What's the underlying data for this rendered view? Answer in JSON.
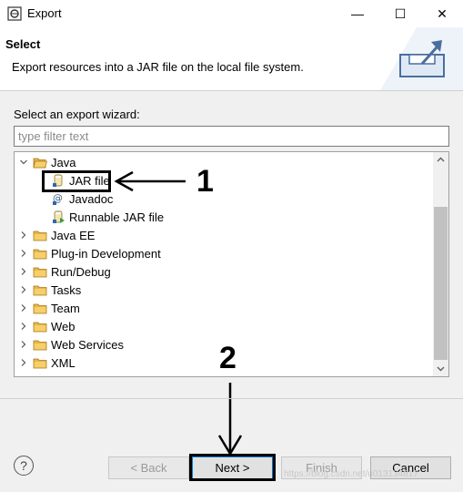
{
  "titlebar": {
    "title": "Export",
    "minimize": "—",
    "maximize": "☐",
    "close": "✕"
  },
  "banner": {
    "title": "Select",
    "description": "Export resources into a JAR file on the local file system."
  },
  "wizard": {
    "label": "Select an export wizard:",
    "filter_placeholder": "type filter text",
    "tree": {
      "java": {
        "label": "Java",
        "expanded": true
      },
      "jar_file": {
        "label": "JAR file",
        "selected": true
      },
      "javadoc": {
        "label": "Javadoc"
      },
      "runnable_jar": {
        "label": "Runnable JAR file"
      },
      "java_ee": {
        "label": "Java EE"
      },
      "plugin": {
        "label": "Plug-in Development"
      },
      "rundebug": {
        "label": "Run/Debug"
      },
      "tasks": {
        "label": "Tasks"
      },
      "team": {
        "label": "Team"
      },
      "web": {
        "label": "Web"
      },
      "webservices": {
        "label": "Web Services"
      },
      "xml": {
        "label": "XML"
      }
    }
  },
  "annotations": {
    "step1": "1",
    "step2": "2"
  },
  "footer": {
    "help": "?",
    "back": "< Back",
    "next": "Next >",
    "finish": "Finish",
    "cancel": "Cancel",
    "watermark": "https://blog.csdn.net/u013134817"
  }
}
